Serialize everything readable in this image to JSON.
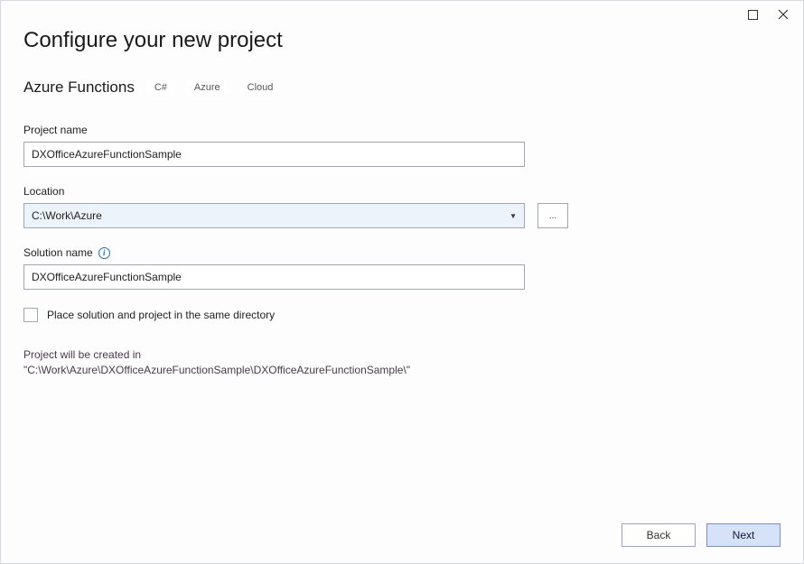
{
  "title": "Configure your new project",
  "subtitle": "Azure Functions",
  "tags": [
    "C#",
    "Azure",
    "Cloud"
  ],
  "projectName": {
    "label": "Project name",
    "value": "DXOfficeAzureFunctionSample"
  },
  "location": {
    "label": "Location",
    "value": "C:\\Work\\Azure",
    "browse": "..."
  },
  "solutionName": {
    "label": "Solution name",
    "value": "DXOfficeAzureFunctionSample"
  },
  "sameDir": {
    "label": "Place solution and project in the same directory"
  },
  "hint": "Project will be created in \"C:\\Work\\Azure\\DXOfficeAzureFunctionSample\\DXOfficeAzureFunctionSample\\\"",
  "buttons": {
    "back": "Back",
    "next": "Next"
  }
}
